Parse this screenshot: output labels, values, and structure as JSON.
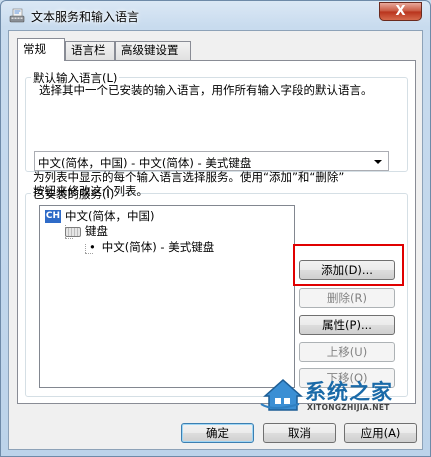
{
  "window": {
    "title": "文本服务和输入语言",
    "close_label": "X"
  },
  "tabs": [
    {
      "label": "常规",
      "active": true
    },
    {
      "label": "语言栏",
      "active": false
    },
    {
      "label": "高级键设置",
      "active": false
    }
  ],
  "default_language": {
    "legend": "默认输入语言(L)",
    "description": "选择其中一个已安装的输入语言，用作所有输入字段的默认语言。",
    "selected": "中文(简体，中国) - 中文(简体) - 美式键盘"
  },
  "installed_services": {
    "legend": "已安装的服务(I)",
    "description_line1": "为列表中显示的每个输入语言选择服务。使用“添加”和“删除”",
    "description_line2": "按钮来修改这个列表。",
    "tree": {
      "language_badge": "CH",
      "language": "中文(简体，中国)",
      "category": "键盘",
      "service_bullet": "•",
      "service": "中文(简体) - 美式键盘"
    },
    "buttons": {
      "add": "添加(D)...",
      "remove": "删除(R)",
      "properties": "属性(P)...",
      "move_up": "上移(U)",
      "move_down": "下移(O)"
    }
  },
  "footer": {
    "ok": "确定",
    "cancel": "取消",
    "apply": "应用(A)"
  },
  "watermark": {
    "brand": "系统之家",
    "url": "XITONGZHIJIA.NET"
  },
  "colors": {
    "highlight": "#e00000",
    "language_badge": "#2f6bc8",
    "close_button": "#c7553d"
  }
}
